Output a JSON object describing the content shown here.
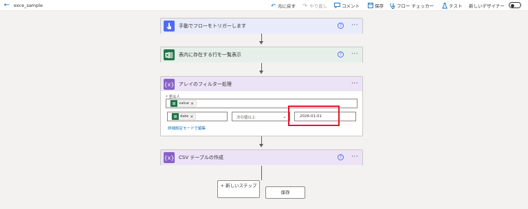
{
  "topbar": {
    "flow_name": "exce_sample",
    "undo": "元に戻す",
    "redo": "やり直し",
    "comment": "コメント",
    "save": "保存",
    "flow_checker": "フロー チェッカー",
    "test": "テスト",
    "new_designer": "新しいデザイナー",
    "new_designer_enabled": false
  },
  "steps": [
    {
      "title": "手動でフローをトリガーします",
      "icon": "touch-icon",
      "color": "#4f6bed"
    },
    {
      "title": "表内に存在する行を一覧表示",
      "icon": "excel-icon",
      "color": "#217346"
    },
    {
      "title": "アレイのフィルター処理",
      "icon": "data-operation-icon",
      "color": "#8661c5",
      "from_label": "差出人",
      "from_token": "value",
      "condition_left_token": "date",
      "operator": "次の値以上",
      "value": "2026-01-01",
      "advanced_link": "詳細設定モードで編集"
    },
    {
      "title": "CSV テーブルの作成",
      "icon": "data-operation-icon",
      "color": "#8661c5"
    }
  ],
  "actions": {
    "new_step": "+ 新しいステップ",
    "save": "保存"
  }
}
